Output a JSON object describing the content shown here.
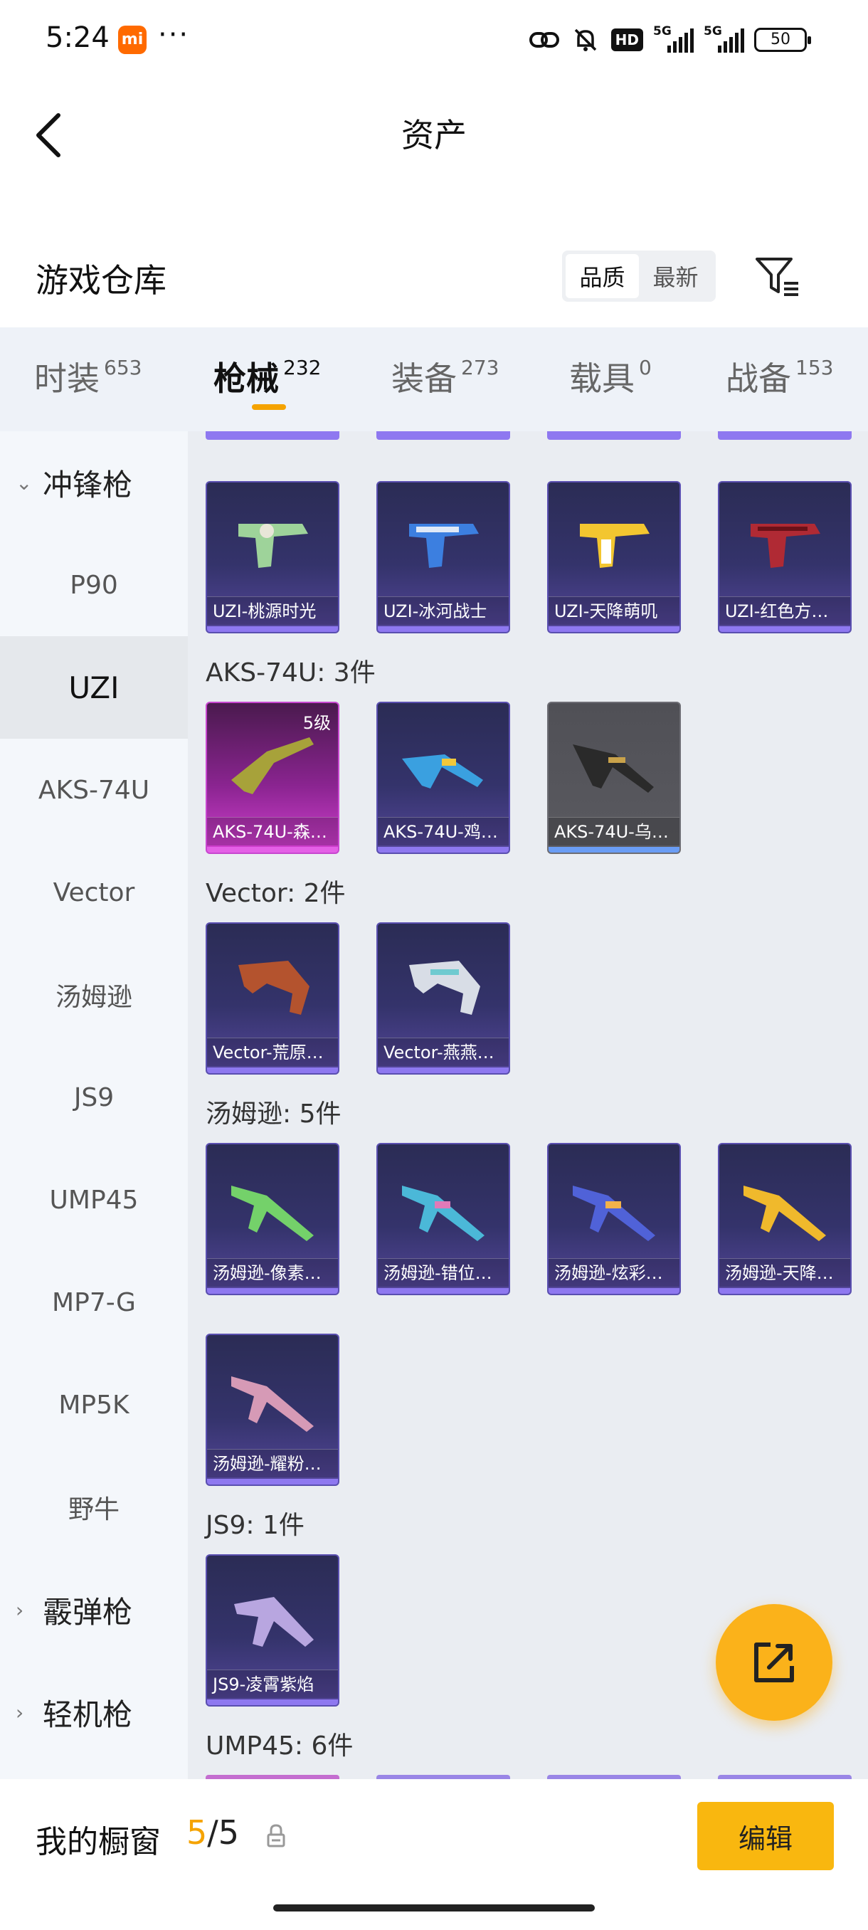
{
  "status_bar": {
    "time": "5:24",
    "mi_badge": "mi",
    "more": "···",
    "hd": "HD",
    "net1": "5G",
    "net2": "5G",
    "battery": "50"
  },
  "header": {
    "title": "资产",
    "back_icon": "chevron-left-icon"
  },
  "warehouse": {
    "title": "游戏仓库",
    "sort_options": [
      "品质",
      "最新"
    ],
    "sort_selected": "品质",
    "filter_icon": "filter-icon"
  },
  "tabs": [
    {
      "label": "时装",
      "count": "653"
    },
    {
      "label": "枪械",
      "count": "232",
      "active": true
    },
    {
      "label": "装备",
      "count": "273"
    },
    {
      "label": "载具",
      "count": "0"
    },
    {
      "label": "战备",
      "count": "153"
    }
  ],
  "sidenav": {
    "groups": [
      {
        "label": "冲锋枪",
        "expanded": true
      },
      {
        "label": "霰弹枪",
        "expanded": false
      },
      {
        "label": "轻机枪",
        "expanded": false
      }
    ],
    "items": [
      "P90",
      "UZI",
      "AKS-74U",
      "Vector",
      "汤姆逊",
      "JS9",
      "UMP45",
      "MP7-G",
      "MP5K",
      "野牛"
    ],
    "selected": "UZI"
  },
  "content": {
    "uzi_cards": [
      "UZI-桃源时光",
      "UZI-冰河战士",
      "UZI-天降萌叽",
      "UZI-红色方…"
    ],
    "groups": [
      {
        "title": "AKS-74U: 3件",
        "cards": [
          {
            "label": "AKS-74U-森…",
            "level": "5级",
            "style": "pink"
          },
          {
            "label": "AKS-74U-鸡…",
            "style": "purple"
          },
          {
            "label": "AKS-74U-乌…",
            "style": "grey"
          }
        ]
      },
      {
        "title": "Vector: 2件",
        "cards": [
          {
            "label": "Vector-荒原…",
            "style": "purple"
          },
          {
            "label": "Vector-燕燕…",
            "style": "purple"
          }
        ]
      },
      {
        "title": "汤姆逊: 5件",
        "cards": [
          {
            "label": "汤姆逊-像素…",
            "style": "purple"
          },
          {
            "label": "汤姆逊-错位…",
            "style": "purple"
          },
          {
            "label": "汤姆逊-炫彩…",
            "style": "purple"
          },
          {
            "label": "汤姆逊-天降…",
            "style": "purple"
          },
          {
            "label": "汤姆逊-耀粉…",
            "style": "purple"
          }
        ]
      },
      {
        "title": "JS9: 1件",
        "cards": [
          {
            "label": "JS9-凌霄紫焰",
            "style": "purple"
          }
        ]
      },
      {
        "title": "UMP45: 6件",
        "cards": []
      }
    ]
  },
  "fab": {
    "icon": "share-external-icon"
  },
  "bottom_bar": {
    "title": "我的橱窗",
    "count_current": "5",
    "count_sep": "/",
    "count_total": "5",
    "lock_icon": "lock-icon",
    "edit_label": "编辑"
  },
  "colors": {
    "accent": "#f5a300",
    "edit_button": "#f9b70f",
    "card_purple": "#34336b",
    "card_pink": "#8a2490",
    "card_grey": "#5a5a60"
  }
}
